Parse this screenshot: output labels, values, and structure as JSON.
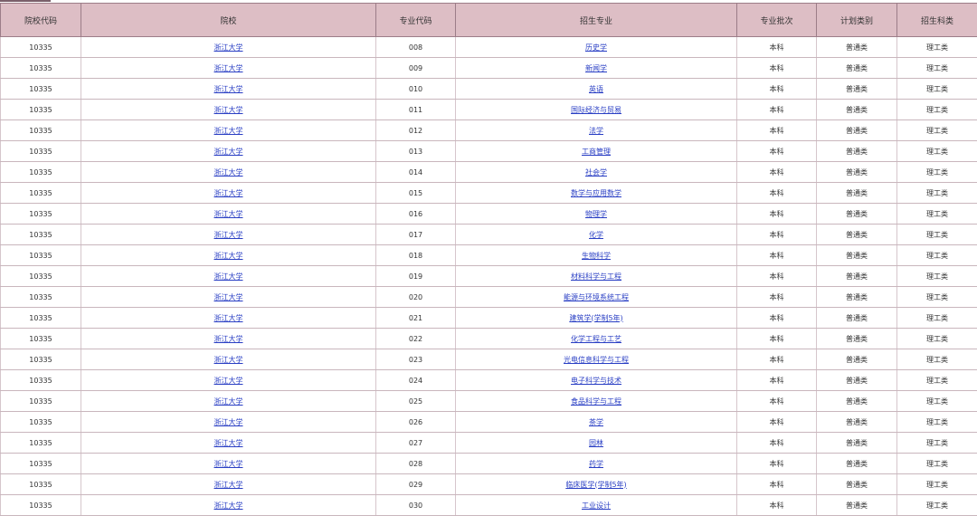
{
  "table": {
    "headers": [
      "院校代码",
      "院校",
      "专业代码",
      "招生专业",
      "专业批次",
      "计划类别",
      "招生科类"
    ],
    "rows": [
      [
        "10335",
        "浙江大学",
        "008",
        "历史学",
        "本科",
        "普通类",
        "理工类"
      ],
      [
        "10335",
        "浙江大学",
        "009",
        "新闻学",
        "本科",
        "普通类",
        "理工类"
      ],
      [
        "10335",
        "浙江大学",
        "010",
        "英语",
        "本科",
        "普通类",
        "理工类"
      ],
      [
        "10335",
        "浙江大学",
        "011",
        "国际经济与贸易",
        "本科",
        "普通类",
        "理工类"
      ],
      [
        "10335",
        "浙江大学",
        "012",
        "法学",
        "本科",
        "普通类",
        "理工类"
      ],
      [
        "10335",
        "浙江大学",
        "013",
        "工商管理",
        "本科",
        "普通类",
        "理工类"
      ],
      [
        "10335",
        "浙江大学",
        "014",
        "社会学",
        "本科",
        "普通类",
        "理工类"
      ],
      [
        "10335",
        "浙江大学",
        "015",
        "数学与应用数学",
        "本科",
        "普通类",
        "理工类"
      ],
      [
        "10335",
        "浙江大学",
        "016",
        "物理学",
        "本科",
        "普通类",
        "理工类"
      ],
      [
        "10335",
        "浙江大学",
        "017",
        "化学",
        "本科",
        "普通类",
        "理工类"
      ],
      [
        "10335",
        "浙江大学",
        "018",
        "生物科学",
        "本科",
        "普通类",
        "理工类"
      ],
      [
        "10335",
        "浙江大学",
        "019",
        "材料科学与工程",
        "本科",
        "普通类",
        "理工类"
      ],
      [
        "10335",
        "浙江大学",
        "020",
        "能源与环境系统工程",
        "本科",
        "普通类",
        "理工类"
      ],
      [
        "10335",
        "浙江大学",
        "021",
        "建筑学(学制5年)",
        "本科",
        "普通类",
        "理工类"
      ],
      [
        "10335",
        "浙江大学",
        "022",
        "化学工程与工艺",
        "本科",
        "普通类",
        "理工类"
      ],
      [
        "10335",
        "浙江大学",
        "023",
        "光电信息科学与工程",
        "本科",
        "普通类",
        "理工类"
      ],
      [
        "10335",
        "浙江大学",
        "024",
        "电子科学与技术",
        "本科",
        "普通类",
        "理工类"
      ],
      [
        "10335",
        "浙江大学",
        "025",
        "食品科学与工程",
        "本科",
        "普通类",
        "理工类"
      ],
      [
        "10335",
        "浙江大学",
        "026",
        "茶学",
        "本科",
        "普通类",
        "理工类"
      ],
      [
        "10335",
        "浙江大学",
        "027",
        "园林",
        "本科",
        "普通类",
        "理工类"
      ],
      [
        "10335",
        "浙江大学",
        "028",
        "药学",
        "本科",
        "普通类",
        "理工类"
      ],
      [
        "10335",
        "浙江大学",
        "029",
        "临床医学(学制5年)",
        "本科",
        "普通类",
        "理工类"
      ],
      [
        "10335",
        "浙江大学",
        "030",
        "工业设计",
        "本科",
        "普通类",
        "理工类"
      ]
    ]
  },
  "colors": {
    "header_bg": "#ddbec5",
    "link": "#2a3fc4"
  }
}
